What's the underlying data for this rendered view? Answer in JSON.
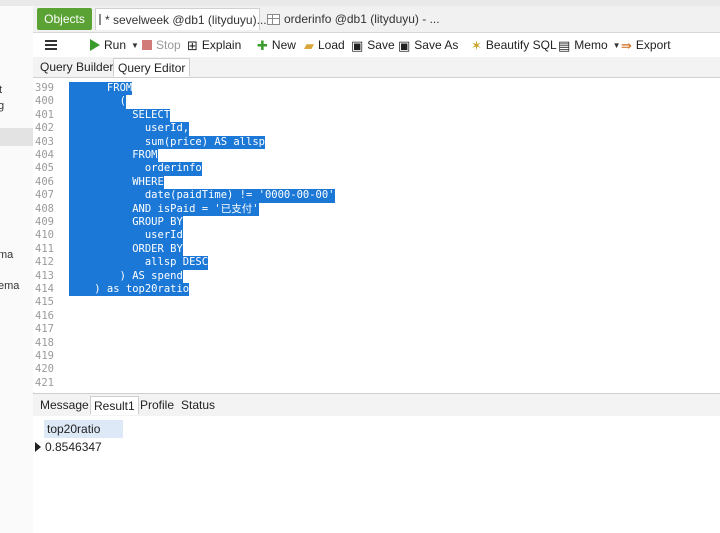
{
  "left_panel": {
    "fragments": [
      "t",
      "g",
      "ma",
      "ema"
    ]
  },
  "tabs": {
    "objects": "Objects",
    "query1": "* sevelweek @db1 (lityduyu)...",
    "query2": "orderinfo @db1 (lityduyu) - ..."
  },
  "toolbar": {
    "run": "Run",
    "stop": "Stop",
    "explain": "Explain",
    "new": "New",
    "load": "Load",
    "save": "Save",
    "save_as": "Save As",
    "beautify": "Beautify SQL",
    "memo": "Memo",
    "export": "Export"
  },
  "editor_tabs": {
    "builder": "Query Builder",
    "editor": "Query Editor"
  },
  "editor": {
    "lines": [
      {
        "n": "399",
        "code": "      FROM"
      },
      {
        "n": "400",
        "code": "        ("
      },
      {
        "n": "401",
        "code": "          SELECT"
      },
      {
        "n": "402",
        "code": "            userId,"
      },
      {
        "n": "403",
        "code": "            sum(price) AS allsp"
      },
      {
        "n": "404",
        "code": "          FROM"
      },
      {
        "n": "405",
        "code": "            orderinfo"
      },
      {
        "n": "406",
        "code": "          WHERE"
      },
      {
        "n": "407",
        "code": "            date(paidTime) != '0000-00-00'"
      },
      {
        "n": "408",
        "code": "          AND isPaid = '已支付'"
      },
      {
        "n": "409",
        "code": "          GROUP BY"
      },
      {
        "n": "410",
        "code": "            userId"
      },
      {
        "n": "411",
        "code": "          ORDER BY"
      },
      {
        "n": "412",
        "code": "            allsp DESC"
      },
      {
        "n": "413",
        "code": "        ) AS spend"
      },
      {
        "n": "414",
        "code": "    ) as top20ratio"
      },
      {
        "n": "415",
        "code": ""
      },
      {
        "n": "416",
        "code": ""
      },
      {
        "n": "417",
        "code": ""
      },
      {
        "n": "418",
        "code": ""
      },
      {
        "n": "419",
        "code": ""
      },
      {
        "n": "420",
        "code": ""
      },
      {
        "n": "421",
        "code": ""
      }
    ],
    "selection_color": "#1c78d6"
  },
  "result_tabs": {
    "message": "Message",
    "result1": "Result1",
    "profile": "Profile",
    "status": "Status"
  },
  "result": {
    "column": "top20ratio",
    "value": "0.8546347"
  },
  "colors": {
    "objects_tab": "#5aa233",
    "run": "#3a9c2c",
    "header_cell": "#dde9f7"
  }
}
